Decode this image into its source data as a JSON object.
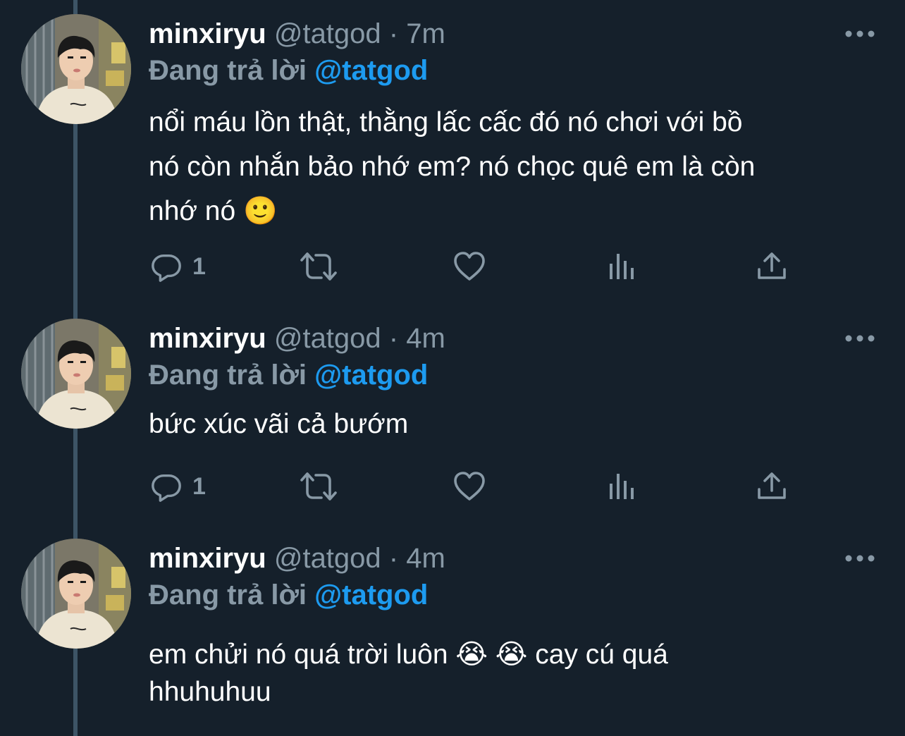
{
  "tweets": [
    {
      "display_name": "minxiryu",
      "handle": "@tatgod",
      "separator": "·",
      "time": "7m",
      "reply_prefix": "Đang trả lời",
      "reply_mention": "@tatgod",
      "text": "nổi máu lồn thật, thằng lấc cấc đó nó chơi với bồ\nnó còn nhắn bảo nhớ em? nó chọc quê em là còn\nnhớ nó 🙂",
      "reply_count": "1"
    },
    {
      "display_name": "minxiryu",
      "handle": "@tatgod",
      "separator": "·",
      "time": "4m",
      "reply_prefix": "Đang trả lời",
      "reply_mention": "@tatgod",
      "text": "bức xúc vãi cả bướm",
      "reply_count": "1"
    },
    {
      "display_name": "minxiryu",
      "handle": "@tatgod",
      "separator": "·",
      "time": "4m",
      "reply_prefix": "Đang trả lời",
      "reply_mention": "@tatgod",
      "text": "em chửi nó quá trời luôn 😭 😭  cay cú quá\nhhuhuhuu"
    }
  ],
  "icons": {
    "more": "more-horizontal-icon",
    "reply": "reply-bubble-icon",
    "retweet": "retweet-icon",
    "like": "heart-icon",
    "views": "analytics-bars-icon",
    "share": "share-upload-icon"
  },
  "colors": {
    "background": "#15202b",
    "text_primary": "#ffffff",
    "text_secondary": "#8899a6",
    "accent": "#1d9bf0",
    "thread_line": "#3d5466"
  }
}
